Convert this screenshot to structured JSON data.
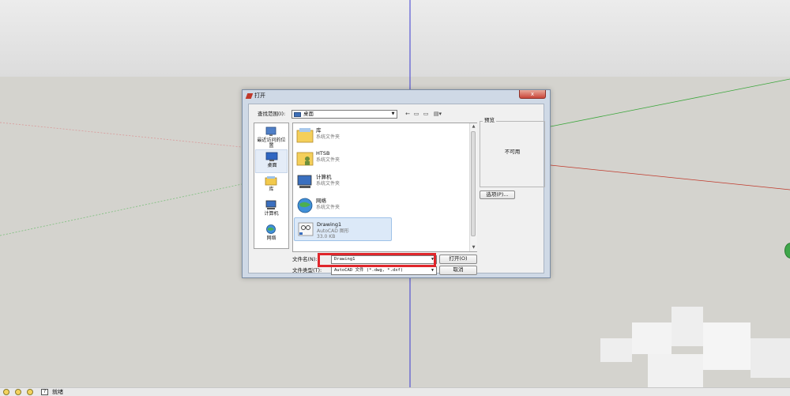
{
  "dialog": {
    "title": "打开",
    "close_label": "x",
    "look_in_label": "查找范围(I):",
    "look_in_value": "桌面",
    "toolbar": {
      "back": "←",
      "up": "▭",
      "new_folder": "▭",
      "views": "▤▾"
    },
    "places": [
      {
        "label": "最近访问的位置",
        "icon": "recent-places-icon"
      },
      {
        "label": "桌面",
        "icon": "desktop-icon",
        "selected": true
      },
      {
        "label": "库",
        "icon": "libraries-icon"
      },
      {
        "label": "计算机",
        "icon": "computer-icon"
      },
      {
        "label": "网络",
        "icon": "network-icon"
      }
    ],
    "files": [
      {
        "name": "库",
        "type": "系统文件夹",
        "icon": "libraries-folder-icon"
      },
      {
        "name": "HTSB",
        "type": "系统文件夹",
        "icon": "user-folder-icon"
      },
      {
        "name": "计算机",
        "type": "系统文件夹",
        "icon": "computer-icon"
      },
      {
        "name": "网络",
        "type": "系统文件夹",
        "icon": "network-globe-icon"
      },
      {
        "name": "Drawing1",
        "type": "AutoCAD 图形",
        "size": "33.0 KB",
        "icon": "autocad-file-icon",
        "selected": true
      }
    ],
    "preview_label": "预览",
    "preview_text": "不可用",
    "options_button": "选项(P)...",
    "filename_label": "文件名(N):",
    "filename_value": "Drawing1",
    "filetype_label": "文件类型(T):",
    "filetype_value": "AutoCAD 文件 (*.dwg, *.dxf)",
    "open_button": "打开(O)",
    "cancel_button": "取消"
  },
  "statusbar": {
    "text": "就绪",
    "help": "?"
  },
  "colors": {
    "highlight_box": "#e0262b",
    "axis_green": "#3aa63a",
    "axis_red": "#c0392b",
    "axis_blue": "#3b3bd0"
  }
}
